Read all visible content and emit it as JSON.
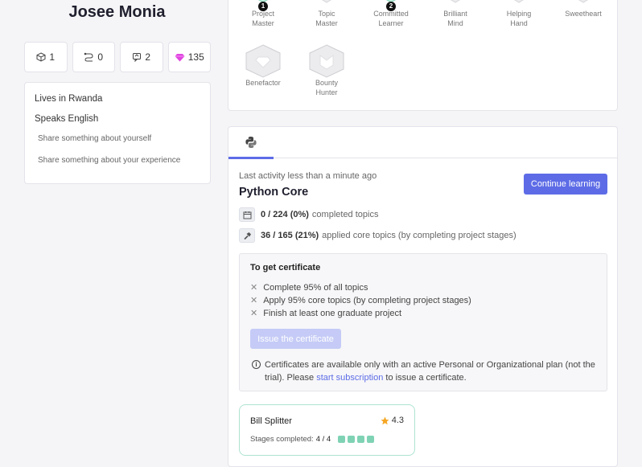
{
  "profile": {
    "name": "Josee Monia",
    "stats": [
      {
        "icon": "topic-cube-icon",
        "value": "1"
      },
      {
        "icon": "project-path-icon",
        "value": "0"
      },
      {
        "icon": "solutions-icon",
        "value": "2"
      },
      {
        "icon": "gem-icon",
        "value": "135",
        "color": "#e046e0"
      }
    ],
    "about": {
      "location": "Lives in Rwanda",
      "language": "Speaks English",
      "hint_about": "Share something about yourself",
      "hint_experience": "Share something about your experience"
    }
  },
  "badges": [
    {
      "line1": "Project",
      "line2": "Master",
      "level": "1"
    },
    {
      "line1": "Topic",
      "line2": "Master",
      "level": ""
    },
    {
      "line1": "Committed",
      "line2": "Learner",
      "level": "2"
    },
    {
      "line1": "Brilliant",
      "line2": "Mind",
      "level": ""
    },
    {
      "line1": "Helping",
      "line2": "Hand",
      "level": ""
    },
    {
      "line1": "Sweetheart",
      "line2": "",
      "level": ""
    },
    {
      "line1": "Benefactor",
      "line2": "",
      "level": ""
    },
    {
      "line1": "Bounty",
      "line2": "Hunter",
      "level": ""
    }
  ],
  "track": {
    "tab_icon": "python-logo-icon",
    "last_activity": "Last activity less than a minute ago",
    "title": "Python Core",
    "continue_label": "Continue learning",
    "topics_count": "0 / 224 (0%)",
    "topics_label": "completed topics",
    "applied_count": "36 / 165 (21%)",
    "applied_label": "applied core topics (by completing project stages)",
    "accent": "#5d6ce6"
  },
  "certificate": {
    "title": "To get certificate",
    "requirements": [
      "Complete 95% of all topics",
      "Apply 95% core topics (by completing project stages)",
      "Finish at least one graduate project"
    ],
    "issue_label": "Issue the certificate",
    "note_part1": "Certificates are available only with an active Personal or Organizational plan (not the trial). Please",
    "note_link": "start subscription",
    "note_part2": "to issue a certificate."
  },
  "project": {
    "name": "Bill Splitter",
    "rating": "4.3",
    "stages_label": "Stages completed:",
    "stages_value": "4 / 4",
    "stages_done": 4,
    "stages_total": 4
  }
}
